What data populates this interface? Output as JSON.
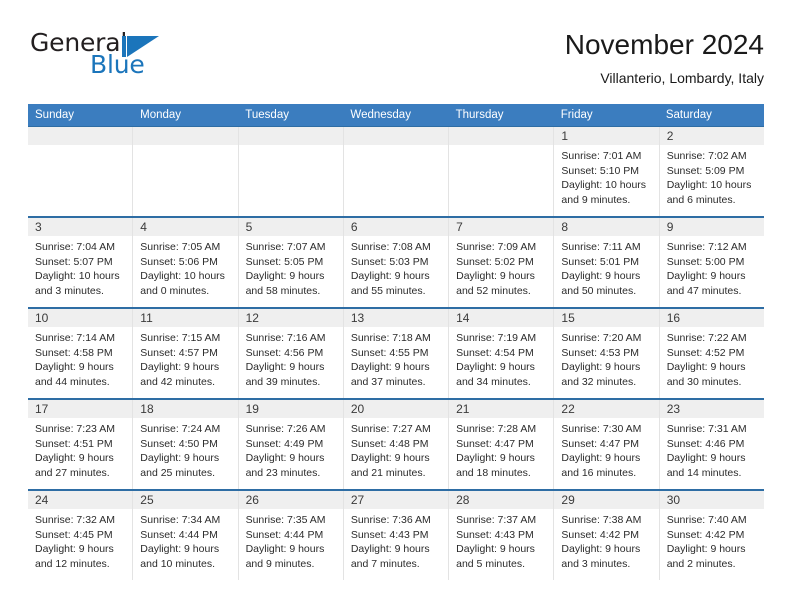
{
  "logo": {
    "word1": "General",
    "word2": "Blue",
    "accent_color": "#1b75bb"
  },
  "header": {
    "title": "November 2024",
    "subtitle": "Villanterio, Lombardy, Italy"
  },
  "calendar": {
    "header_bg": "#3b7dbf",
    "datebar_bg": "#efefef",
    "weekdays": [
      "Sunday",
      "Monday",
      "Tuesday",
      "Wednesday",
      "Thursday",
      "Friday",
      "Saturday"
    ],
    "weeks": [
      [
        {
          "day": "",
          "lines": []
        },
        {
          "day": "",
          "lines": []
        },
        {
          "day": "",
          "lines": []
        },
        {
          "day": "",
          "lines": []
        },
        {
          "day": "",
          "lines": []
        },
        {
          "day": "1",
          "lines": [
            "Sunrise: 7:01 AM",
            "Sunset: 5:10 PM",
            "Daylight: 10 hours",
            "and 9 minutes."
          ]
        },
        {
          "day": "2",
          "lines": [
            "Sunrise: 7:02 AM",
            "Sunset: 5:09 PM",
            "Daylight: 10 hours",
            "and 6 minutes."
          ]
        }
      ],
      [
        {
          "day": "3",
          "lines": [
            "Sunrise: 7:04 AM",
            "Sunset: 5:07 PM",
            "Daylight: 10 hours",
            "and 3 minutes."
          ]
        },
        {
          "day": "4",
          "lines": [
            "Sunrise: 7:05 AM",
            "Sunset: 5:06 PM",
            "Daylight: 10 hours",
            "and 0 minutes."
          ]
        },
        {
          "day": "5",
          "lines": [
            "Sunrise: 7:07 AM",
            "Sunset: 5:05 PM",
            "Daylight: 9 hours",
            "and 58 minutes."
          ]
        },
        {
          "day": "6",
          "lines": [
            "Sunrise: 7:08 AM",
            "Sunset: 5:03 PM",
            "Daylight: 9 hours",
            "and 55 minutes."
          ]
        },
        {
          "day": "7",
          "lines": [
            "Sunrise: 7:09 AM",
            "Sunset: 5:02 PM",
            "Daylight: 9 hours",
            "and 52 minutes."
          ]
        },
        {
          "day": "8",
          "lines": [
            "Sunrise: 7:11 AM",
            "Sunset: 5:01 PM",
            "Daylight: 9 hours",
            "and 50 minutes."
          ]
        },
        {
          "day": "9",
          "lines": [
            "Sunrise: 7:12 AM",
            "Sunset: 5:00 PM",
            "Daylight: 9 hours",
            "and 47 minutes."
          ]
        }
      ],
      [
        {
          "day": "10",
          "lines": [
            "Sunrise: 7:14 AM",
            "Sunset: 4:58 PM",
            "Daylight: 9 hours",
            "and 44 minutes."
          ]
        },
        {
          "day": "11",
          "lines": [
            "Sunrise: 7:15 AM",
            "Sunset: 4:57 PM",
            "Daylight: 9 hours",
            "and 42 minutes."
          ]
        },
        {
          "day": "12",
          "lines": [
            "Sunrise: 7:16 AM",
            "Sunset: 4:56 PM",
            "Daylight: 9 hours",
            "and 39 minutes."
          ]
        },
        {
          "day": "13",
          "lines": [
            "Sunrise: 7:18 AM",
            "Sunset: 4:55 PM",
            "Daylight: 9 hours",
            "and 37 minutes."
          ]
        },
        {
          "day": "14",
          "lines": [
            "Sunrise: 7:19 AM",
            "Sunset: 4:54 PM",
            "Daylight: 9 hours",
            "and 34 minutes."
          ]
        },
        {
          "day": "15",
          "lines": [
            "Sunrise: 7:20 AM",
            "Sunset: 4:53 PM",
            "Daylight: 9 hours",
            "and 32 minutes."
          ]
        },
        {
          "day": "16",
          "lines": [
            "Sunrise: 7:22 AM",
            "Sunset: 4:52 PM",
            "Daylight: 9 hours",
            "and 30 minutes."
          ]
        }
      ],
      [
        {
          "day": "17",
          "lines": [
            "Sunrise: 7:23 AM",
            "Sunset: 4:51 PM",
            "Daylight: 9 hours",
            "and 27 minutes."
          ]
        },
        {
          "day": "18",
          "lines": [
            "Sunrise: 7:24 AM",
            "Sunset: 4:50 PM",
            "Daylight: 9 hours",
            "and 25 minutes."
          ]
        },
        {
          "day": "19",
          "lines": [
            "Sunrise: 7:26 AM",
            "Sunset: 4:49 PM",
            "Daylight: 9 hours",
            "and 23 minutes."
          ]
        },
        {
          "day": "20",
          "lines": [
            "Sunrise: 7:27 AM",
            "Sunset: 4:48 PM",
            "Daylight: 9 hours",
            "and 21 minutes."
          ]
        },
        {
          "day": "21",
          "lines": [
            "Sunrise: 7:28 AM",
            "Sunset: 4:47 PM",
            "Daylight: 9 hours",
            "and 18 minutes."
          ]
        },
        {
          "day": "22",
          "lines": [
            "Sunrise: 7:30 AM",
            "Sunset: 4:47 PM",
            "Daylight: 9 hours",
            "and 16 minutes."
          ]
        },
        {
          "day": "23",
          "lines": [
            "Sunrise: 7:31 AM",
            "Sunset: 4:46 PM",
            "Daylight: 9 hours",
            "and 14 minutes."
          ]
        }
      ],
      [
        {
          "day": "24",
          "lines": [
            "Sunrise: 7:32 AM",
            "Sunset: 4:45 PM",
            "Daylight: 9 hours",
            "and 12 minutes."
          ]
        },
        {
          "day": "25",
          "lines": [
            "Sunrise: 7:34 AM",
            "Sunset: 4:44 PM",
            "Daylight: 9 hours",
            "and 10 minutes."
          ]
        },
        {
          "day": "26",
          "lines": [
            "Sunrise: 7:35 AM",
            "Sunset: 4:44 PM",
            "Daylight: 9 hours",
            "and 9 minutes."
          ]
        },
        {
          "day": "27",
          "lines": [
            "Sunrise: 7:36 AM",
            "Sunset: 4:43 PM",
            "Daylight: 9 hours",
            "and 7 minutes."
          ]
        },
        {
          "day": "28",
          "lines": [
            "Sunrise: 7:37 AM",
            "Sunset: 4:43 PM",
            "Daylight: 9 hours",
            "and 5 minutes."
          ]
        },
        {
          "day": "29",
          "lines": [
            "Sunrise: 7:38 AM",
            "Sunset: 4:42 PM",
            "Daylight: 9 hours",
            "and 3 minutes."
          ]
        },
        {
          "day": "30",
          "lines": [
            "Sunrise: 7:40 AM",
            "Sunset: 4:42 PM",
            "Daylight: 9 hours",
            "and 2 minutes."
          ]
        }
      ]
    ]
  }
}
